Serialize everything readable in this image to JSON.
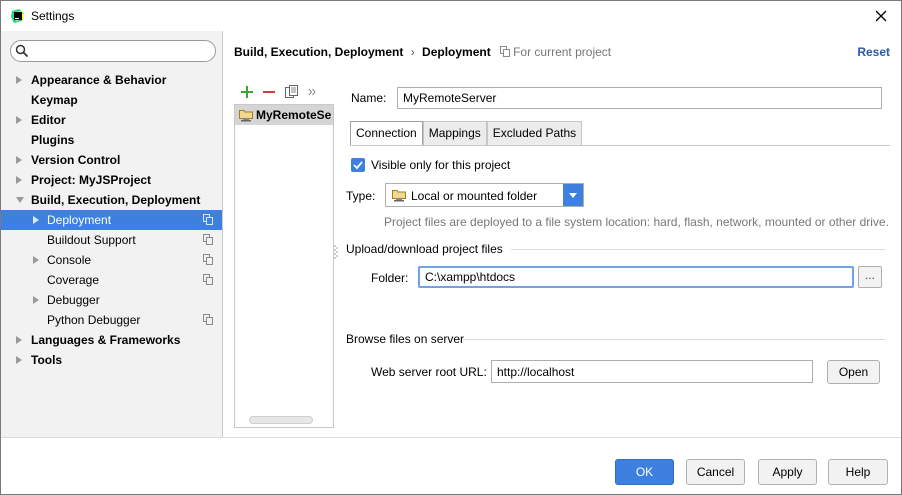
{
  "window": {
    "title": "Settings"
  },
  "search": {
    "placeholder": ""
  },
  "sidebar": {
    "items": [
      {
        "label": "Appearance & Behavior",
        "level": 0,
        "bold": true,
        "arrow": "right"
      },
      {
        "label": "Keymap",
        "level": 0,
        "bold": true,
        "arrow": ""
      },
      {
        "label": "Editor",
        "level": 0,
        "bold": true,
        "arrow": "right"
      },
      {
        "label": "Plugins",
        "level": 0,
        "bold": true,
        "arrow": ""
      },
      {
        "label": "Version Control",
        "level": 0,
        "bold": true,
        "arrow": "right"
      },
      {
        "label": "Project: MyJSProject",
        "level": 0,
        "bold": true,
        "arrow": "right"
      },
      {
        "label": "Build, Execution, Deployment",
        "level": 0,
        "bold": true,
        "arrow": "down"
      },
      {
        "label": "Deployment",
        "level": 1,
        "bold": false,
        "arrow": "right",
        "selected": true,
        "copy": true
      },
      {
        "label": "Buildout Support",
        "level": 1,
        "bold": false,
        "arrow": "",
        "copy": true
      },
      {
        "label": "Console",
        "level": 1,
        "bold": false,
        "arrow": "right",
        "copy": true
      },
      {
        "label": "Coverage",
        "level": 1,
        "bold": false,
        "arrow": "",
        "copy": true
      },
      {
        "label": "Debugger",
        "level": 1,
        "bold": false,
        "arrow": "right"
      },
      {
        "label": "Python Debugger",
        "level": 1,
        "bold": false,
        "arrow": "",
        "copy": true
      },
      {
        "label": "Languages & Frameworks",
        "level": 0,
        "bold": true,
        "arrow": "right"
      },
      {
        "label": "Tools",
        "level": 0,
        "bold": true,
        "arrow": "right"
      }
    ]
  },
  "header": {
    "crumb1": "Build, Execution, Deployment",
    "separator": "›",
    "crumb2": "Deployment",
    "scope": "For current project",
    "reset": "Reset"
  },
  "servers": {
    "items": [
      {
        "label": "MyRemoteSe"
      }
    ]
  },
  "form": {
    "name_label": "Name:",
    "name_value": "MyRemoteServer",
    "tabs": [
      "Connection",
      "Mappings",
      "Excluded Paths"
    ],
    "active_tab": 0,
    "visible_only": {
      "label": "Visible only for this project",
      "checked": true
    },
    "type_label": "Type:",
    "type_value": "Local or mounted folder",
    "type_hint": "Project files are deployed to a file system location: hard, flash, network, mounted or other drive.",
    "upload_section": "Upload/download project files",
    "folder_label": "Folder:",
    "folder_value": "C:\\xampp\\htdocs",
    "browse_label": "...",
    "browse_section": "Browse files on server",
    "url_label": "Web server root URL:",
    "url_value": "http://localhost",
    "open_label": "Open"
  },
  "buttons": {
    "ok": "OK",
    "cancel": "Cancel",
    "apply": "Apply",
    "help": "Help"
  },
  "colors": {
    "accent": "#3d80df",
    "sidebar_bg": "#f2f2f2",
    "link": "#2b5aa6"
  },
  "icons": {
    "app": "pycharm-logo-icon",
    "close": "close-icon",
    "search": "search-icon",
    "add": "plus-icon",
    "remove": "minus-icon",
    "copy": "copy-icon",
    "more": "double-chevron-icon",
    "server": "server-folder-icon",
    "dropdown": "chevron-down-icon"
  }
}
